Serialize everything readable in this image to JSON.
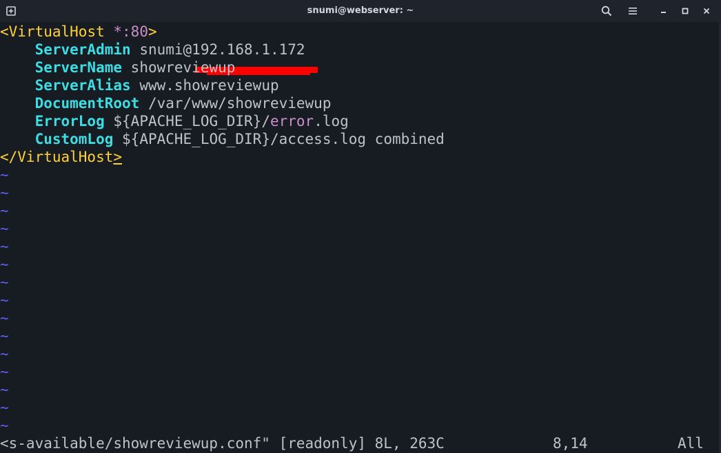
{
  "window": {
    "title": "snumi@webserver: ~"
  },
  "titlebar_icons": {
    "new_tab": "new-tab-icon",
    "search": "search-icon",
    "menu": "hamburger-menu-icon",
    "minimize": "minimize-icon",
    "maximize": "maximize-icon",
    "close": "close-icon"
  },
  "editor": {
    "open_tag": {
      "lt": "<",
      "name": "VirtualHost",
      "space": " ",
      "addr": "*:80",
      "gt": ">"
    },
    "directives": [
      {
        "key": "ServerAdmin",
        "value": "snumi@192.168.1.172"
      },
      {
        "key": "ServerName",
        "value": "showreviewup"
      },
      {
        "key": "ServerAlias",
        "value": "www.showreviewup"
      },
      {
        "key": "DocumentRoot",
        "value": "/var/www/showreviewup"
      }
    ],
    "errorlog": {
      "key": "ErrorLog",
      "pre": "${APACHE_LOG_DIR}/",
      "hl": "error",
      "post": ".log"
    },
    "customlog": {
      "key": "CustomLog",
      "value": "${APACHE_LOG_DIR}/access.log combined"
    },
    "close_tag": {
      "start": "</VirtualHost",
      "cursor": ">"
    },
    "empty_line_marker": "~",
    "empty_line_count": 15
  },
  "statusbar": {
    "file_info": "<s-available/showreviewup.conf\" [readonly] 8L, 263C",
    "position": "8,14",
    "scroll": "All"
  },
  "colors": {
    "background": "#171b22",
    "titlebar": "#1f232b",
    "tag": "#ffd23a",
    "address": "#c98fc9",
    "directive": "#3ddde3",
    "text": "#bfc3c9",
    "tilde": "#5a61ee",
    "redaction": "#ff0000"
  }
}
